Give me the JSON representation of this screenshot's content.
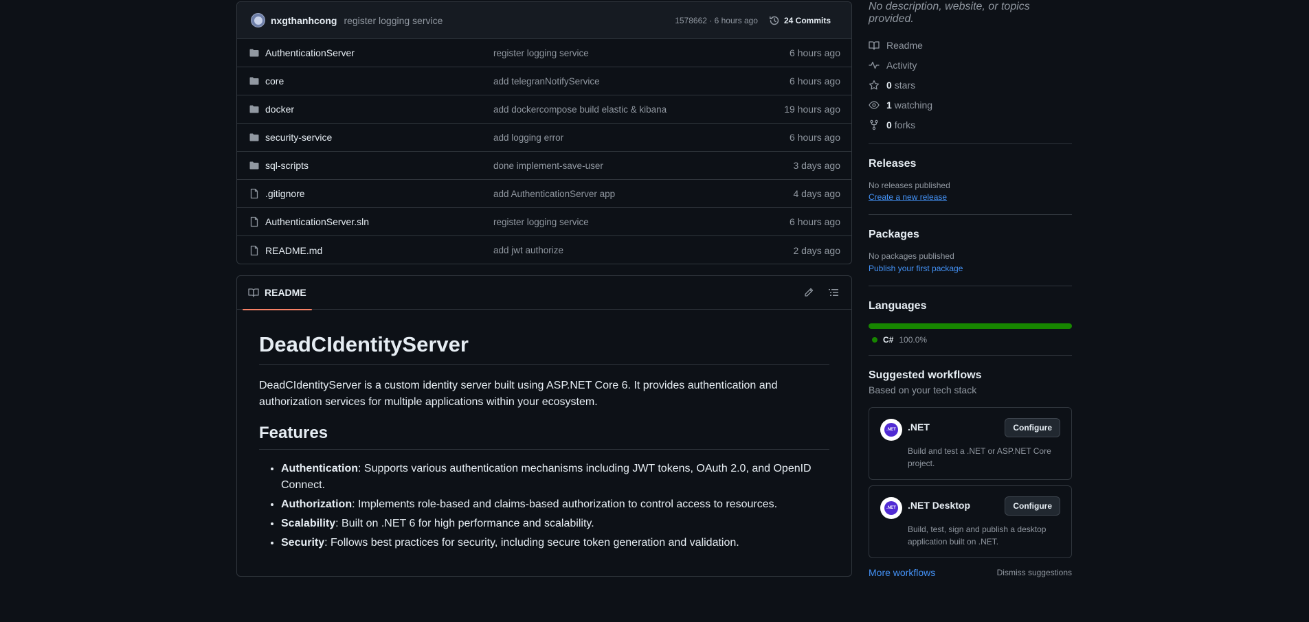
{
  "commit_bar": {
    "author": "nxgthanhcong",
    "message": "register logging service",
    "meta": "1578662 · 6 hours ago",
    "commits_label": "24 Commits"
  },
  "files": [
    {
      "type": "folder",
      "name": "AuthenticationServer",
      "commit": "register logging service",
      "time": "6 hours ago"
    },
    {
      "type": "folder",
      "name": "core",
      "commit": "add telegranNotifyService",
      "time": "6 hours ago"
    },
    {
      "type": "folder",
      "name": "docker",
      "commit": "add dockercompose build elastic & kibana",
      "time": "19 hours ago"
    },
    {
      "type": "folder",
      "name": "security-service",
      "commit": "add logging error",
      "time": "6 hours ago"
    },
    {
      "type": "folder",
      "name": "sql-scripts",
      "commit": "done implement-save-user",
      "time": "3 days ago"
    },
    {
      "type": "file",
      "name": ".gitignore",
      "commit": "add AuthenticationServer app",
      "time": "4 days ago"
    },
    {
      "type": "file",
      "name": "AuthenticationServer.sln",
      "commit": "register logging service",
      "time": "6 hours ago"
    },
    {
      "type": "file",
      "name": "README.md",
      "commit": "add jwt authorize",
      "time": "2 days ago"
    }
  ],
  "readme": {
    "tab_label": "README",
    "title": "DeadCIdentityServer",
    "description": "DeadCIdentityServer is a custom identity server built using ASP.NET Core 6. It provides authentication and authorization services for multiple applications within your ecosystem.",
    "features_heading": "Features",
    "features": [
      {
        "term": "Authentication",
        "text": ": Supports various authentication mechanisms including JWT tokens, OAuth 2.0, and OpenID Connect."
      },
      {
        "term": "Authorization",
        "text": ": Implements role-based and claims-based authorization to control access to resources."
      },
      {
        "term": "Scalability",
        "text": ": Built on .NET 6 for high performance and scalability."
      },
      {
        "term": "Security",
        "text": ": Follows best practices for security, including secure token generation and validation."
      }
    ]
  },
  "sidebar": {
    "about_desc": "No description, website, or topics provided.",
    "readme_link": "Readme",
    "activity_link": "Activity",
    "stars_count": "0",
    "stars_label": "stars",
    "watching_count": "1",
    "watching_label": "watching",
    "forks_count": "0",
    "forks_label": "forks",
    "releases_heading": "Releases",
    "releases_empty": "No releases published",
    "releases_link": "Create a new release",
    "packages_heading": "Packages",
    "packages_empty": "No packages published",
    "packages_link": "Publish your first package",
    "languages_heading": "Languages",
    "language_name": "C#",
    "language_percent": "100.0%",
    "language_color": "#178600",
    "workflows_heading": "Suggested workflows",
    "workflows_sub": "Based on your tech stack",
    "workflows": [
      {
        "title": ".NET",
        "desc": "Build and test a .NET or ASP.NET Core project.",
        "button": "Configure",
        "logo_text": ".NET"
      },
      {
        "title": ".NET Desktop",
        "desc": "Build, test, sign and publish a desktop application built on .NET.",
        "button": "Configure",
        "logo_text": ".NET"
      }
    ],
    "more_workflows": "More workflows",
    "dismiss": "Dismiss suggestions"
  },
  "colors": {
    "background": "#0d1117",
    "border": "#30363d",
    "accent_link": "#4493f8",
    "tab_underline": "#f78166"
  }
}
